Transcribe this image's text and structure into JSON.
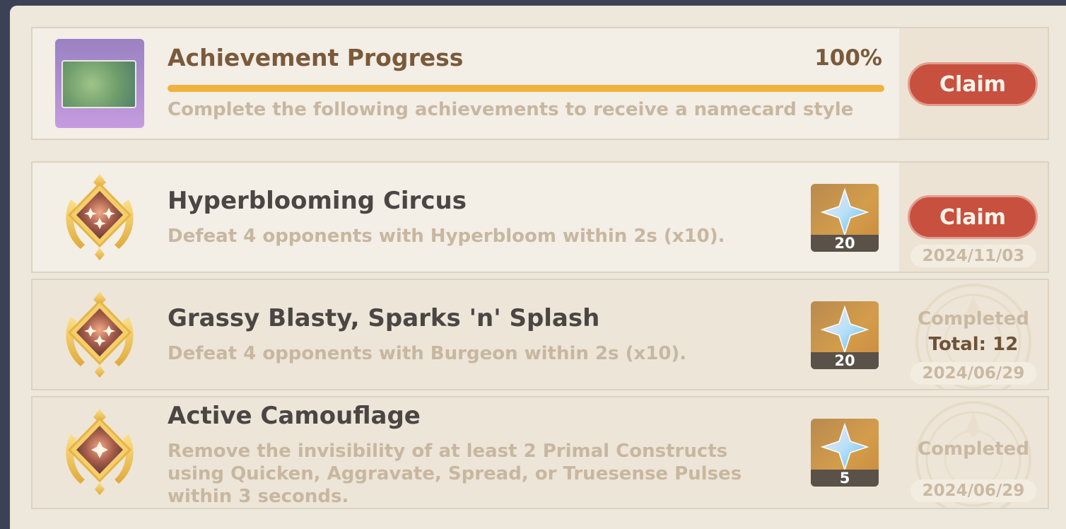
{
  "colors": {
    "accent": "#f0b23f",
    "claim_button": "#c8503f",
    "title_brown": "#7a5a3a",
    "muted_text": "#c8b7a0"
  },
  "progress": {
    "title": "Achievement Progress",
    "percent_label": "100%",
    "percent_value": 100,
    "description": "Complete the following achievements to receive a namecard style",
    "claim_label": "Claim",
    "thumbnail_icon": "namecard-icon"
  },
  "achievements": [
    {
      "title": "Hyperblooming Circus",
      "description": "Defeat 4 opponents with Hyperbloom within 2s (x10).",
      "reward_icon": "primogem-icon",
      "reward_count": "20",
      "status": "claimable",
      "claim_label": "Claim",
      "date": "2024/11/03"
    },
    {
      "title": "Grassy Blasty, Sparks 'n' Splash",
      "description": "Defeat 4 opponents with Burgeon within 2s (x10).",
      "reward_icon": "primogem-icon",
      "reward_count": "20",
      "status": "completed",
      "completed_label": "Completed",
      "total_label": "Total: 12",
      "date": "2024/06/29"
    },
    {
      "title": "Active Camouflage",
      "description": "Remove the invisibility of at least 2 Primal Constructs using Quicken, Aggravate, Spread, or Truesense Pulses within 3 seconds.",
      "reward_icon": "primogem-icon",
      "reward_count": "5",
      "status": "completed",
      "completed_label": "Completed",
      "date": "2024/06/29"
    }
  ]
}
